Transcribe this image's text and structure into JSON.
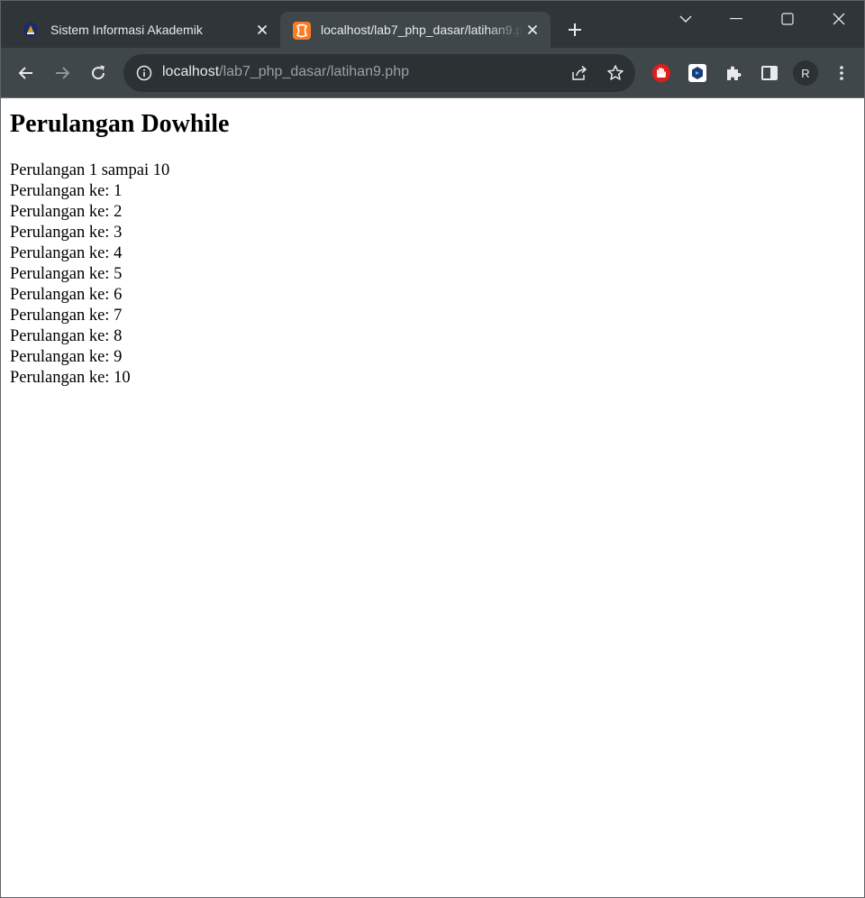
{
  "browser": {
    "tabs": [
      {
        "title": "Sistem Informasi Akademik",
        "active": false,
        "favicon": "university-logo-icon"
      },
      {
        "title": "localhost/lab7_php_dasar/latihan9.php",
        "active": true,
        "favicon": "xampp-icon"
      }
    ],
    "address": {
      "host": "localhost",
      "path": "/lab7_php_dasar/latihan9.php"
    },
    "profile_initial": "R"
  },
  "colors": {
    "tabstrip": "#2f3538",
    "toolbar": "#3f474b",
    "omnibox": "#2c3134",
    "xampp_orange": "#fb7a24"
  },
  "page": {
    "heading": "Perulangan Dowhile",
    "intro": "Perulangan 1 sampai 10",
    "lines": [
      "Perulangan ke: 1",
      "Perulangan ke: 2",
      "Perulangan ke: 3",
      "Perulangan ke: 4",
      "Perulangan ke: 5",
      "Perulangan ke: 6",
      "Perulangan ke: 7",
      "Perulangan ke: 8",
      "Perulangan ke: 9",
      "Perulangan ke: 10"
    ]
  }
}
